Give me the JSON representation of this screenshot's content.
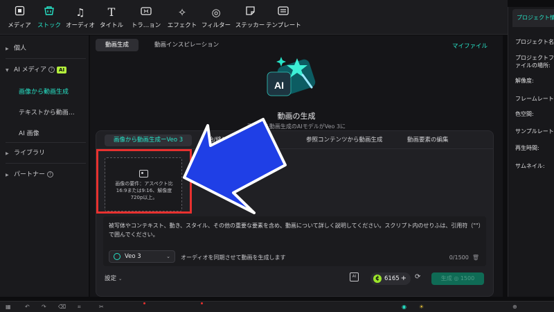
{
  "toolbar": {
    "items": [
      {
        "label": "メディア",
        "icon": "media-icon"
      },
      {
        "label": "ストック",
        "icon": "stock-icon",
        "active": true
      },
      {
        "label": "オーディオ",
        "icon": "music-icon"
      },
      {
        "label": "タイトル",
        "icon": "title-icon"
      },
      {
        "label": "トラ…ョン",
        "icon": "transition-icon"
      },
      {
        "label": "エフェクト",
        "icon": "effects-icon"
      },
      {
        "label": "フィルター",
        "icon": "filter-icon"
      },
      {
        "label": "ステッカー",
        "icon": "sticker-icon"
      },
      {
        "label": "テンプレート",
        "icon": "template-icon"
      }
    ]
  },
  "sidebar": {
    "personal": "個人",
    "ai_media": "AI メディア",
    "ai_badge": "AI",
    "sub_image_to_video": "画像から動画生成",
    "sub_text_to_video": "テキストから動画…",
    "sub_ai_image": "AI 画像",
    "library": "ライブラリ",
    "partner": "パートナー"
  },
  "main": {
    "tab_video_gen": "動画生成",
    "tab_inspiration": "動画インスピレーション",
    "my_files": "マイファイル",
    "hero_title": "動画の生成",
    "hero_subtitle": "画像から動画生成のAIモデルがVeo 3に",
    "panel_tabs": [
      "画像から動画生成ーVeo 3",
      "始/終フ…から動画生成",
      "参照コンテンツから動画生成",
      "動画要素の編集"
    ],
    "upload_text": "画像の要件：アスペクト比16:9または9:16、解像度720p以上。",
    "prompt_placeholder": "被写体やコンテキスト、動き、スタイル、その他の重要な要素を含め、動画について詳しく説明してください。スクリプト内のせりふは、引用符（\"\"）で囲んでください。",
    "char_count": "0/1500",
    "model_name": "Veo 3",
    "sync_audio_label": "オーディオを同期させて動画を生成します",
    "settings_label": "設定",
    "credits": "6165",
    "generate_label": "生成 ◎ 1500"
  },
  "right_panel": {
    "tab_title": "プロジェクト情",
    "labels": [
      "プロジェクト名",
      "プロジェクトファイルの場所:",
      "解像度:",
      "フレームレート",
      "色空間:",
      "サンプルレート",
      "再生時間:",
      "サムネイル:"
    ]
  },
  "colors": {
    "accent": "#27e4c8",
    "highlight_box": "#e8312f",
    "arrow_fill": "#1f3fe6",
    "credit_coin": "#9be42a"
  }
}
